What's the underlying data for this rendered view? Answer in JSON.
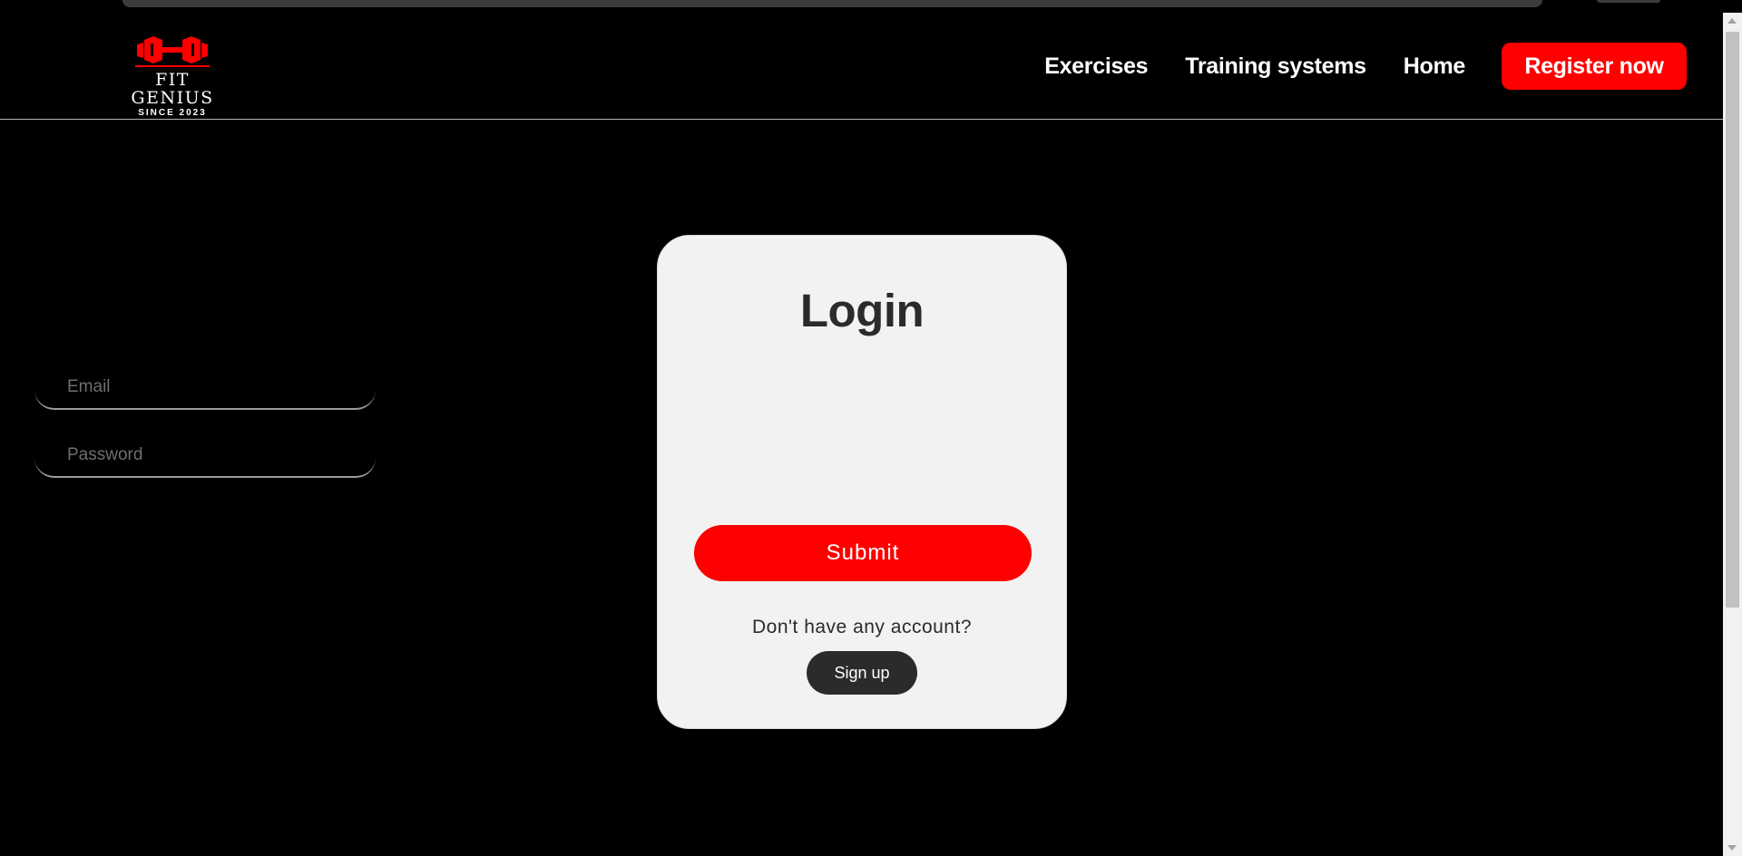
{
  "header": {
    "logo": {
      "title": "FIT GENIUS",
      "subtitle": "SINCE 2023"
    },
    "nav": {
      "exercises": "Exercises",
      "training_systems": "Training systems",
      "home": "Home",
      "register": "Register now"
    }
  },
  "login": {
    "title": "Login",
    "email_placeholder": "Email",
    "password_placeholder": "Password",
    "submit_label": "Submit",
    "no_account_text": "Don't have any account?",
    "signup_label": "Sign up"
  },
  "colors": {
    "accent": "#ff0000",
    "background": "#000000",
    "card": "#f2f2f2",
    "dark_button": "#2b2b2b"
  },
  "icons": [
    "dumbbell-icon"
  ]
}
